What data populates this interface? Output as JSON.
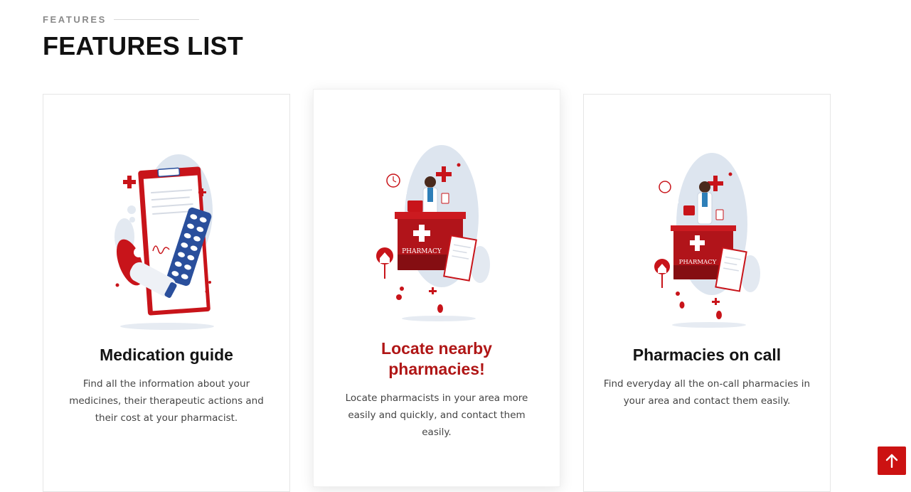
{
  "section": {
    "eyebrow": "FEATURES",
    "title": "FEATURES LIST"
  },
  "colors": {
    "accent": "#cc1212",
    "featured_title": "#b01616",
    "blob": "#dde5ef"
  },
  "cards": [
    {
      "icon": "medication-clipboard-illustration",
      "title": "Medication guide",
      "text": "Find all the information about your medicines, their therapeutic actions and their cost at your pharmacist."
    },
    {
      "icon": "pharmacist-counter-illustration",
      "illustration_label": "PHARMACY",
      "title": "Locate nearby pharmacies!",
      "text": "Locate pharmacists in your area more easily and quickly, and contact them easily."
    },
    {
      "icon": "pharmacist-counter-illustration",
      "illustration_label": "PHARMACY",
      "title": "Pharmacies on call",
      "text": "Find everyday all the on-call pharmacies in your area and contact them easily."
    }
  ],
  "scroll_top": {
    "icon": "arrow-up-icon"
  }
}
